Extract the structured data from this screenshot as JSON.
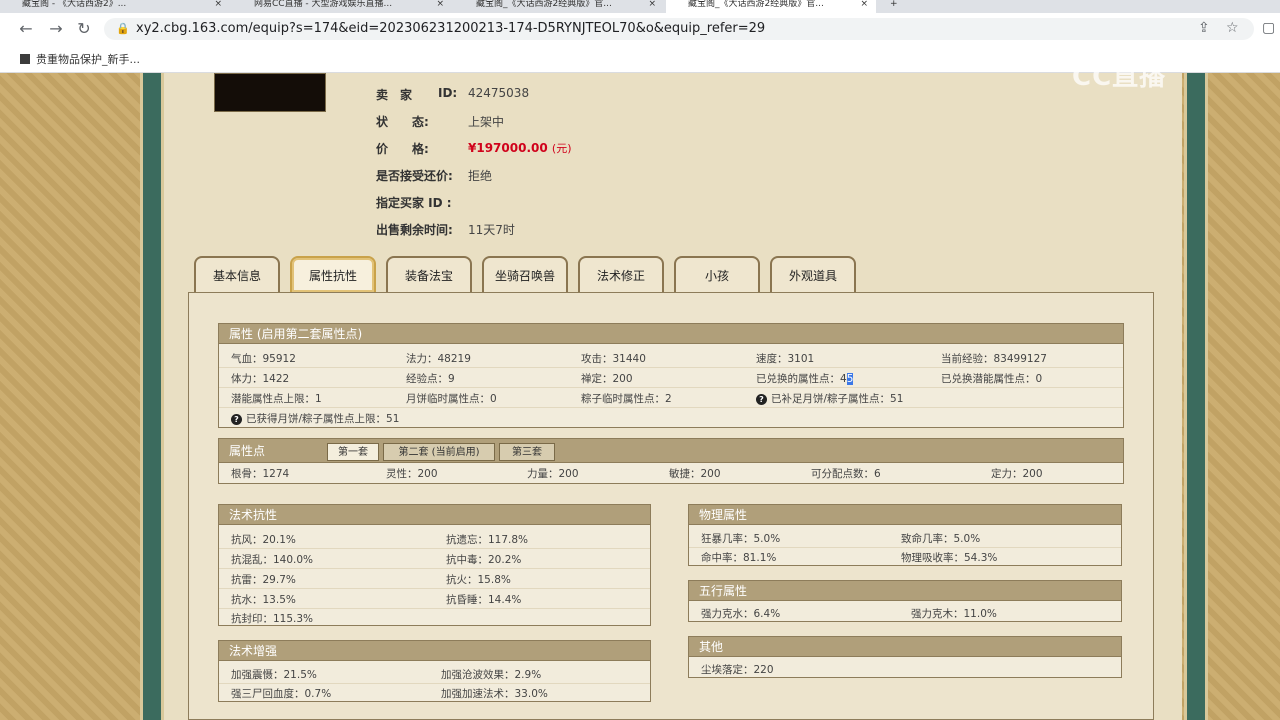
{
  "browser": {
    "tabs": [
      {
        "label": "藏宝阁 - 《大话西游2》..."
      },
      {
        "label": "网易CC直播 - 大型游戏娱乐直播..."
      },
      {
        "label": "藏宝阁_《大话西游2经典版》官..."
      },
      {
        "label": "藏宝阁_《大话西游2经典版》官..."
      }
    ],
    "url": "xy2.cbg.163.com/equip?s=174&eid=202306231200213-174-D5RYNJTEOL70&o&equip_refer=29",
    "bookmark": "贵重物品保护_新手..."
  },
  "watermark": "CC直播",
  "seller": {
    "seller_label": "卖　家",
    "seller_id_label": "ID:",
    "seller_id": "42475038",
    "status_label": "状　　态:",
    "status": "上架中",
    "price_label": "价　　格:",
    "price": "¥197000.00",
    "price_unit": "(元)",
    "counter_label": "是否接受还价:",
    "counter": "拒绝",
    "buyer_label": "指定买家 ID :",
    "time_label": "出售剩余时间:",
    "time": "11天7时"
  },
  "tabs": [
    "基本信息",
    "属性抗性",
    "装备法宝",
    "坐骑召唤兽",
    "法术修正",
    "小孩",
    "外观道具"
  ],
  "attr": {
    "title": "属性 (启用第二套属性点)",
    "rows": [
      [
        "气血：95912",
        "法力：48219",
        "攻击：31440",
        "速度：3101",
        "当前经验：83499127"
      ],
      [
        "体力：1422",
        "经验点：9",
        "禅定：200",
        "已兑换的属性点：",
        "已兑换潜能属性点：0"
      ],
      [
        "潜能属性点上限：1",
        "月饼临时属性点：0",
        "粽子临时属性点：2",
        "已补足月饼/粽子属性点：51",
        ""
      ]
    ],
    "exchanged_pre": "4",
    "exchanged_hl": "5",
    "last_row": "已获得月饼/粽子属性点上限：51",
    "qmark": "?"
  },
  "points": {
    "title": "属性点",
    "subtabs": [
      "第一套",
      "第二套 (当前启用)",
      "第三套"
    ],
    "values": [
      "根骨：1274",
      "灵性：200",
      "力量：200",
      "敏捷：200",
      "可分配点数：6",
      "定力：200"
    ]
  },
  "resist": {
    "title": "法术抗性",
    "rows": [
      [
        "抗风：20.1%",
        "抗遗忘：117.8%"
      ],
      [
        "抗混乱：140.0%",
        "抗中毒：20.2%"
      ],
      [
        "抗雷：29.7%",
        "抗火：15.8%"
      ],
      [
        "抗水：13.5%",
        "抗昏睡：14.4%"
      ],
      [
        "抗封印：115.3%",
        ""
      ]
    ]
  },
  "boost": {
    "title": "法术增强",
    "rows": [
      [
        "加强震慑：21.5%",
        "加强沧波效果：2.9%"
      ],
      [
        "强三尸回血度：0.7%",
        "加强加速法术：33.0%"
      ]
    ]
  },
  "physical": {
    "title": "物理属性",
    "rows": [
      [
        "狂暴几率：5.0%",
        "致命几率：5.0%"
      ],
      [
        "命中率：81.1%",
        "物理吸收率：54.3%"
      ]
    ]
  },
  "wuxing": {
    "title": "五行属性",
    "row": [
      "强力克水：6.4%",
      "强力克木：11.0%"
    ]
  },
  "other": {
    "title": "其他",
    "row": "尘埃落定：220"
  }
}
